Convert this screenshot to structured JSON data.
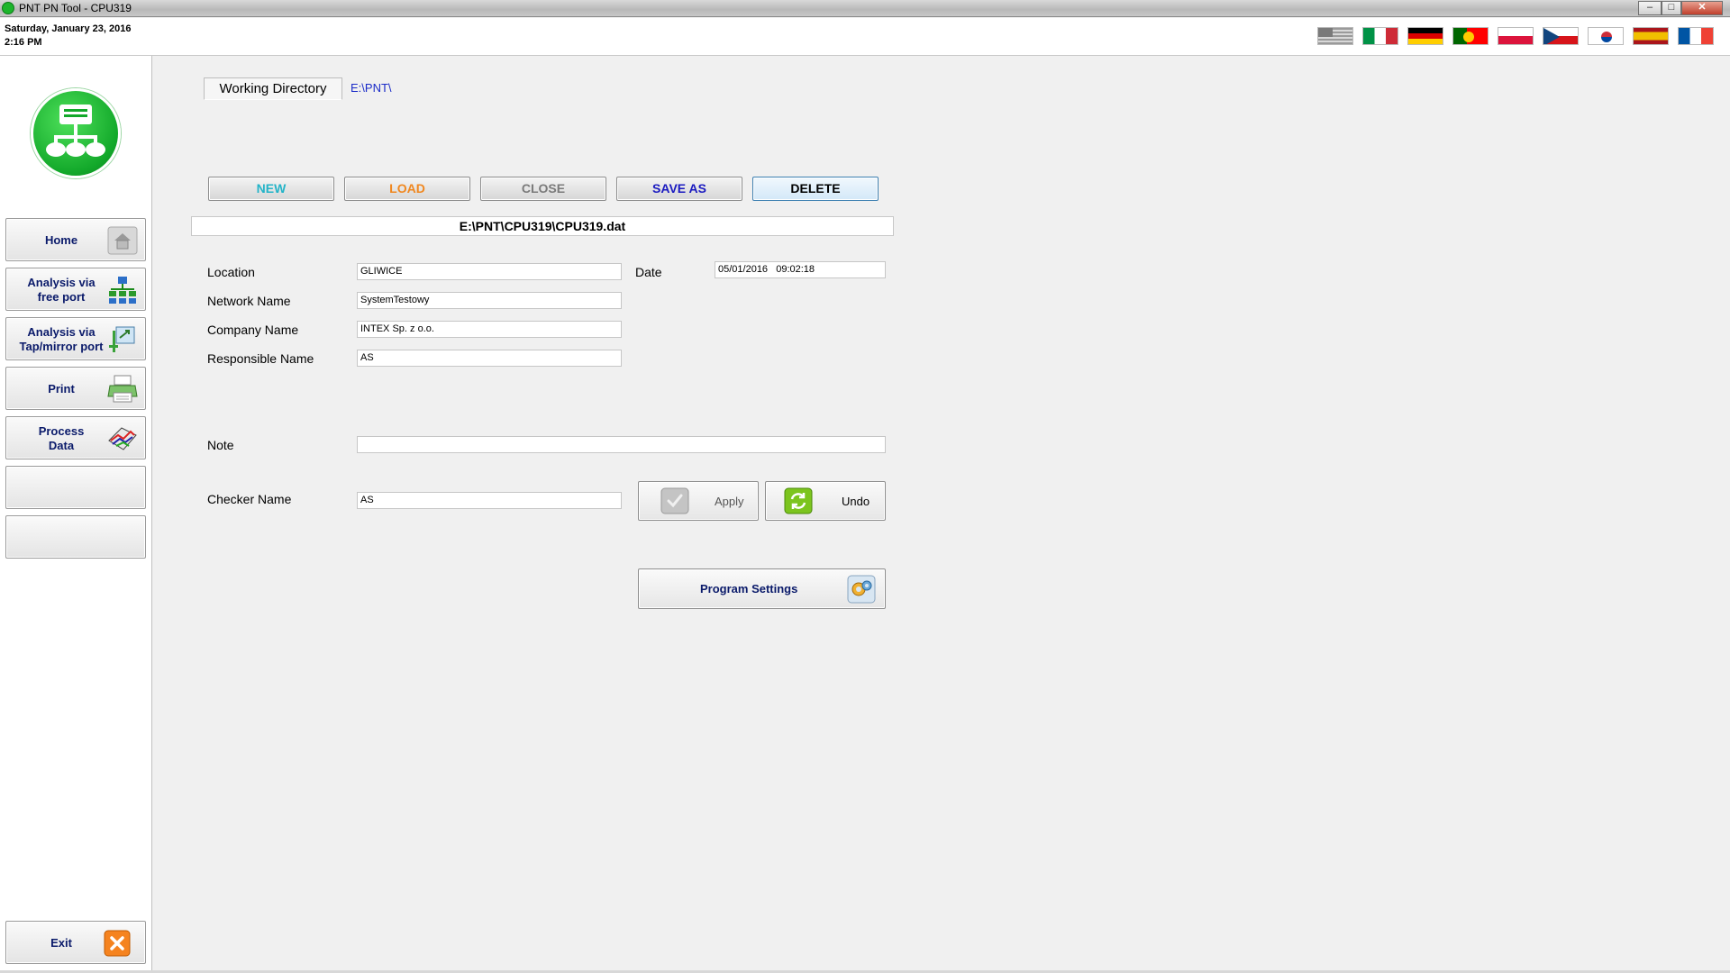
{
  "window": {
    "title": "PNT PN Tool - CPU319",
    "min": "–",
    "max": "□",
    "close": "✕"
  },
  "header": {
    "date": "Saturday, January 23, 2016",
    "time": "2:16 PM"
  },
  "languages": [
    "uk",
    "it",
    "de",
    "pt",
    "pl",
    "cz",
    "kr",
    "es",
    "fr"
  ],
  "sidebar": {
    "items": [
      {
        "label": "Home",
        "icon": "home-icon"
      },
      {
        "label": "Analysis via\nfree port",
        "icon": "network-tree-icon"
      },
      {
        "label": "Analysis via\nTap/mirror port",
        "icon": "tap-port-icon"
      },
      {
        "label": "Print",
        "icon": "printer-icon"
      },
      {
        "label": "Process\nData",
        "icon": "chart-3d-icon"
      },
      {
        "label": "",
        "icon": ""
      },
      {
        "label": "",
        "icon": ""
      }
    ],
    "exit": {
      "label": "Exit",
      "icon": "close-icon"
    }
  },
  "working_directory": {
    "label": "Working Directory",
    "path": "E:\\PNT\\"
  },
  "actions": {
    "new": {
      "label": "NEW",
      "color": "#24b4c8"
    },
    "load": {
      "label": "LOAD",
      "color": "#f0871f"
    },
    "close": {
      "label": "CLOSE",
      "color": "#7a7a7a"
    },
    "save_as": {
      "label": "SAVE AS",
      "color": "#1a1ac0"
    },
    "delete": {
      "label": "DELETE",
      "color": "#000000"
    }
  },
  "file": {
    "path": "E:\\PNT\\CPU319\\CPU319.dat"
  },
  "form": {
    "location": {
      "label": "Location",
      "value": "GLIWICE"
    },
    "date": {
      "label": "Date",
      "value": "05/01/2016   09:02:18"
    },
    "network_name": {
      "label": "Network Name",
      "value": "SystemTestowy"
    },
    "company_name": {
      "label": "Company Name",
      "value": "INTEX Sp. z o.o."
    },
    "responsible_name": {
      "label": "Responsible Name",
      "value": "AS"
    },
    "note": {
      "label": "Note",
      "value": ""
    },
    "checker_name": {
      "label": "Checker Name",
      "value": "AS"
    }
  },
  "buttons": {
    "apply": "Apply",
    "undo": "Undo",
    "program_settings": "Program Settings"
  }
}
